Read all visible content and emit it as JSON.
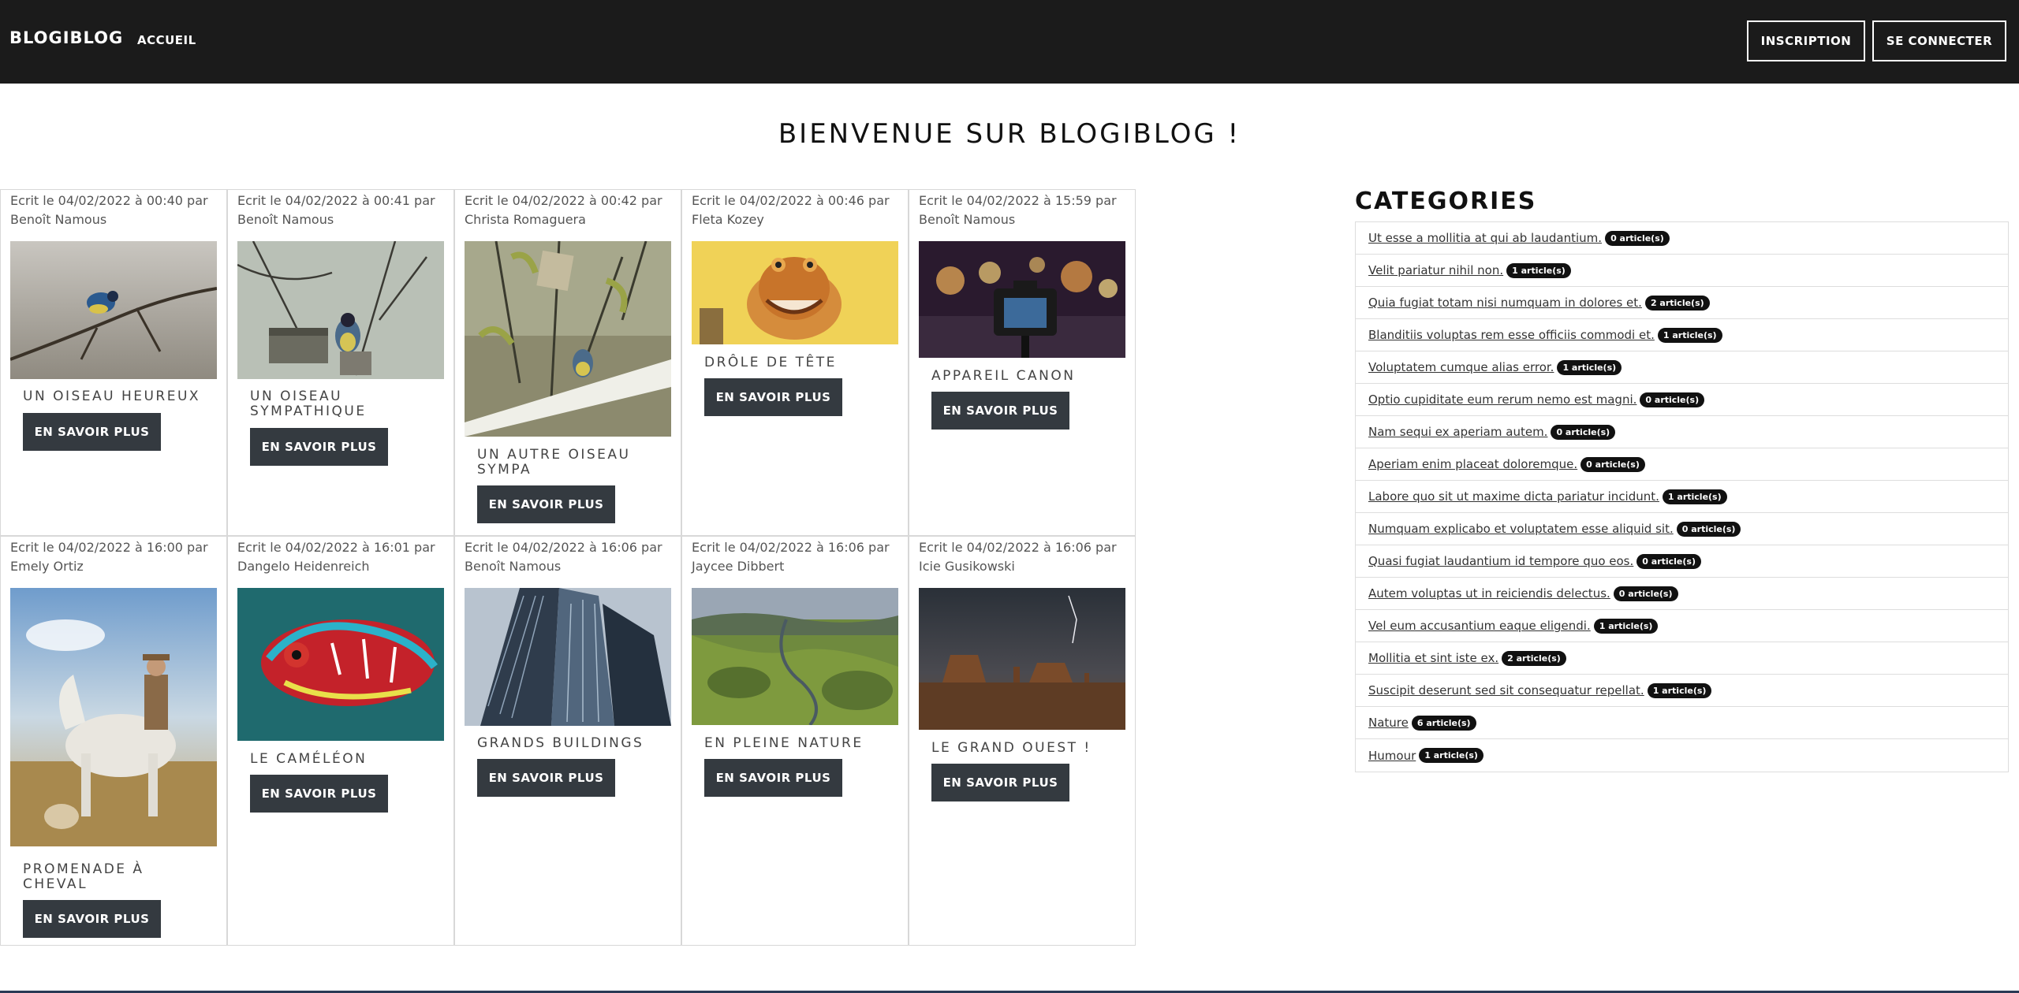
{
  "navbar": {
    "brand": "BLOGIBLOG",
    "home_link": "ACCUEIL",
    "signup_label": "INSCRIPTION",
    "login_label": "SE CONNECTER"
  },
  "page": {
    "title": "BIENVENUE SUR BLOGIBLOG !"
  },
  "articles": [
    {
      "meta": "Ecrit le 04/02/2022 à 00:40 par Benoît Namous",
      "title": "UN OISEAU HEUREUX",
      "image": "bird-on-branch-photo"
    },
    {
      "meta": "Ecrit le 04/02/2022 à 00:41 par Benoît Namous",
      "title": "UN OISEAU SYMPATHIQUE",
      "image": "bird-on-birdhouse-photo"
    },
    {
      "meta": "Ecrit le 04/02/2022 à 00:42 par Christa Romaguera",
      "title": "UN AUTRE OISEAU SYMPA",
      "image": "bird-near-feeder-photo"
    },
    {
      "meta": "Ecrit le 04/02/2022 à 00:46 par Fleta Kozey",
      "title": "DRÔLE DE TÊTE",
      "image": "alien-character-photo"
    },
    {
      "meta": "Ecrit le 04/02/2022 à 15:59 par Benoît Namous",
      "title": "APPAREIL CANON",
      "image": "camera-bokeh-photo"
    },
    {
      "meta": "Ecrit le 04/02/2022 à 16:00 par Emely Ortiz",
      "title": "PROMENADE À CHEVAL",
      "image": "horse-rider-photo"
    },
    {
      "meta": "Ecrit le 04/02/2022 à 16:01 par Dangelo Heidenreich",
      "title": "LE CAMÉLÉON",
      "image": "chameleon-photo"
    },
    {
      "meta": "Ecrit le 04/02/2022 à 16:06 par Benoît Namous",
      "title": "GRANDS BUILDINGS",
      "image": "skyscrapers-photo"
    },
    {
      "meta": "Ecrit le 04/02/2022 à 16:06 par Jaycee Dibbert",
      "title": "EN PLEINE NATURE",
      "image": "landscape-valley-photo"
    },
    {
      "meta": "Ecrit le 04/02/2022 à 16:06 par Icie Gusikowski",
      "title": "LE GRAND OUEST !",
      "image": "desert-monument-photo"
    }
  ],
  "read_more_label": "EN SAVOIR PLUS",
  "categories": {
    "title": "CATEGORIES",
    "items": [
      {
        "name": "Ut esse a mollitia at qui ab laudantium.",
        "count": "0 article(s)"
      },
      {
        "name": "Velit pariatur nihil non.",
        "count": "1 article(s)"
      },
      {
        "name": "Quia fugiat totam nisi numquam in dolores et.",
        "count": "2 article(s)"
      },
      {
        "name": "Blanditiis voluptas rem esse officiis commodi et.",
        "count": "1 article(s)"
      },
      {
        "name": "Voluptatem cumque alias error.",
        "count": "1 article(s)"
      },
      {
        "name": "Optio cupiditate eum rerum nemo est magni.",
        "count": "0 article(s)"
      },
      {
        "name": "Nam sequi ex aperiam autem.",
        "count": "0 article(s)"
      },
      {
        "name": "Aperiam enim placeat doloremque.",
        "count": "0 article(s)"
      },
      {
        "name": "Labore quo sit ut maxime dicta pariatur incidunt.",
        "count": "1 article(s)"
      },
      {
        "name": "Numquam explicabo et voluptatem esse aliquid sit.",
        "count": "0 article(s)"
      },
      {
        "name": "Quasi fugiat laudantium id tempore quo eos.",
        "count": "0 article(s)"
      },
      {
        "name": "Autem voluptas ut in reiciendis delectus.",
        "count": "0 article(s)"
      },
      {
        "name": "Vel eum accusantium eaque eligendi.",
        "count": "1 article(s)"
      },
      {
        "name": "Mollitia et sint iste ex.",
        "count": "2 article(s)"
      },
      {
        "name": "Suscipit deserunt sed sit consequatur repellat.",
        "count": "1 article(s)"
      },
      {
        "name": "Nature",
        "count": "6 article(s)"
      },
      {
        "name": "Humour",
        "count": "1 article(s)"
      }
    ]
  },
  "colors": {
    "navbar": "#1b1b1b",
    "button": "#343a40",
    "badge": "#111111"
  }
}
